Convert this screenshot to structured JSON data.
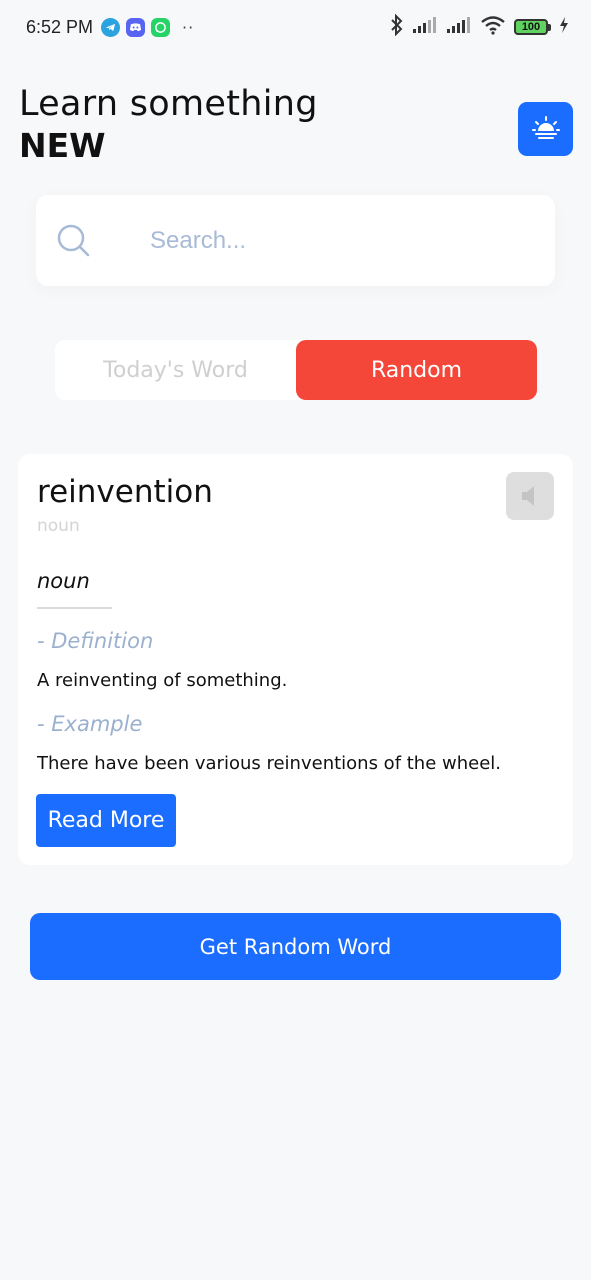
{
  "status_bar": {
    "time": "6:52 PM",
    "battery": "100",
    "more_indicator": "··",
    "icons": [
      "telegram-icon",
      "discord-icon",
      "whatsapp-icon",
      "bluetooth-icon",
      "signal-icon",
      "wifi-icon",
      "battery-icon",
      "charging-icon"
    ]
  },
  "header": {
    "title_light": "Learn something",
    "title_bold": "NEW"
  },
  "search": {
    "placeholder": "Search..."
  },
  "tabs": [
    {
      "label": "Today's Word",
      "active": false
    },
    {
      "label": "Random",
      "active": true
    }
  ],
  "word_card": {
    "word": "reinvention",
    "part_of_speech_small": "noun",
    "part_of_speech": "noun",
    "definition_label": "- Definition",
    "definition": "A reinventing of something.",
    "example_label": "- Example",
    "example": "There have been various reinventions of the wheel.",
    "read_more_label": "Read More"
  },
  "actions": {
    "random_word_label": "Get Random Word"
  },
  "colors": {
    "background": "#f7f8fa",
    "primary": "#1a6dff",
    "active_tab": "#f4473a",
    "label_muted": "#9bb0cf",
    "placeholder": "#a7bad6"
  }
}
